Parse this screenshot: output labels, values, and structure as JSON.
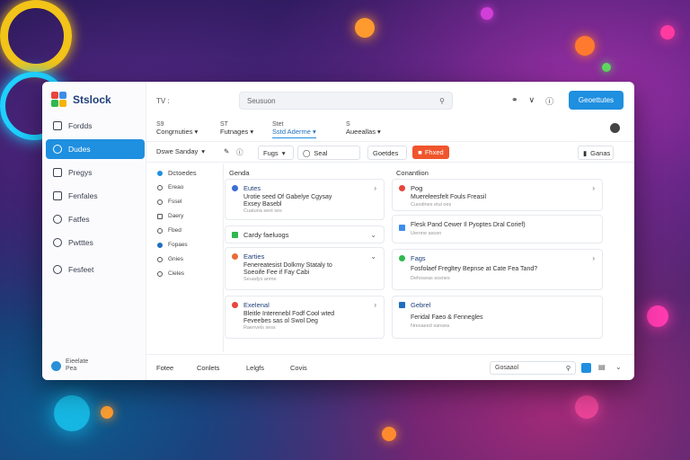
{
  "background": {
    "accent_ring_1": "#f2c318",
    "accent_ring_2": "#1ed0ff"
  },
  "app": {
    "brand": "Stslock",
    "brand_colors": [
      "#e8453c",
      "#3c8de8",
      "#2fb84f",
      "#f4b400"
    ],
    "accent": "#1f8fe0"
  },
  "sidebar": {
    "items": [
      {
        "label": "Fordds",
        "icon": "grid-icon"
      },
      {
        "label": "Dudes",
        "icon": "chat-icon",
        "active": true
      },
      {
        "label": "Pregys",
        "icon": "document-icon"
      },
      {
        "label": "Fenfales",
        "icon": "folder-icon"
      },
      {
        "label": "Fatfes",
        "icon": "people-icon"
      },
      {
        "label": "Pwtttes",
        "icon": "clock-icon"
      },
      {
        "label": "Fesfeet",
        "icon": "settings-icon"
      }
    ],
    "footer": {
      "line1": "Eieelate",
      "line2": "Pea"
    }
  },
  "topbar": {
    "title": "TV :",
    "search_placeholder": "Seusuon",
    "primary_button": "Geoettutes"
  },
  "tabs": [
    {
      "num": "S9",
      "label": "Congrnuties"
    },
    {
      "num": "ST",
      "label": "Futnages"
    },
    {
      "num": "Stet",
      "label": "Sstd Aderme",
      "active": true
    },
    {
      "num": "S",
      "label": "Aueeallas"
    }
  ],
  "filters": {
    "sort": "Dswe Sanday",
    "f2": "Fugs",
    "f3": "Seal",
    "f4": "Goetdes",
    "red_button": "Fhxed",
    "right_label": "Ganas"
  },
  "categories": {
    "title": "Dctoedes",
    "items": [
      "Ereao",
      "Fssel",
      "Daery",
      "Fbed",
      "Fopaes",
      "Gnies",
      "Cieles"
    ]
  },
  "col_left": {
    "title": "Genda",
    "cards": [
      {
        "title": "Eutes",
        "l1": "Urotie seed Of Gabelye Cgysay",
        "l2": "Exsey Basebl",
        "l3": "Cuatuna seot ses",
        "icon_color": "#3a6fd8"
      },
      {
        "title": "Cardy faeluogs",
        "l1": "",
        "l2": "",
        "l3": "",
        "icon_color": "#2fb84f"
      },
      {
        "title": "Earties",
        "l1": "Fenereatesist Dolkmy Stataly to",
        "l2": "Soeoife Fee if Fay Cabi",
        "l3": "Seuadys anme",
        "icon_color": "#e86b3c"
      },
      {
        "title": "Exelenal",
        "l1": "Bleitle Interenebl Fodf Cool wted",
        "l2": "Feveebes sas ol Swol Deg",
        "l3": "Raenvels sess",
        "icon_color": "#e8453c"
      }
    ]
  },
  "col_right": {
    "title": "Conantlion",
    "cards": [
      {
        "title": "Pog",
        "l1": "Muereleesfelt Fouls Freasil",
        "l2": "Cuostlnes etul oes",
        "l3": "",
        "icon_color": "#e8453c"
      },
      {
        "title": "",
        "l1": "Flesk Pand Cewer Il Pyoptes Dral Corief)",
        "l2": "Uernne asosn",
        "l3": "",
        "icon_color": "#3c8de8"
      },
      {
        "title": "Fags",
        "l1": "Fosfolaef Fregltey Bepnse at Cate Fea Tand?",
        "l2": "Dehoseas sosnes",
        "l3": "",
        "icon_color": "#2fb84f"
      },
      {
        "title": "Gebrel",
        "l1": "Feridal Faeo & Fennegles",
        "l2": "Nresaeed sansea",
        "l3": "",
        "icon_color": "#1f6fc0"
      }
    ]
  },
  "bottombar": {
    "items": [
      "Fotee",
      "Conlets",
      "Lelgfs",
      "Covis"
    ],
    "input_value": "Gosaaol"
  }
}
